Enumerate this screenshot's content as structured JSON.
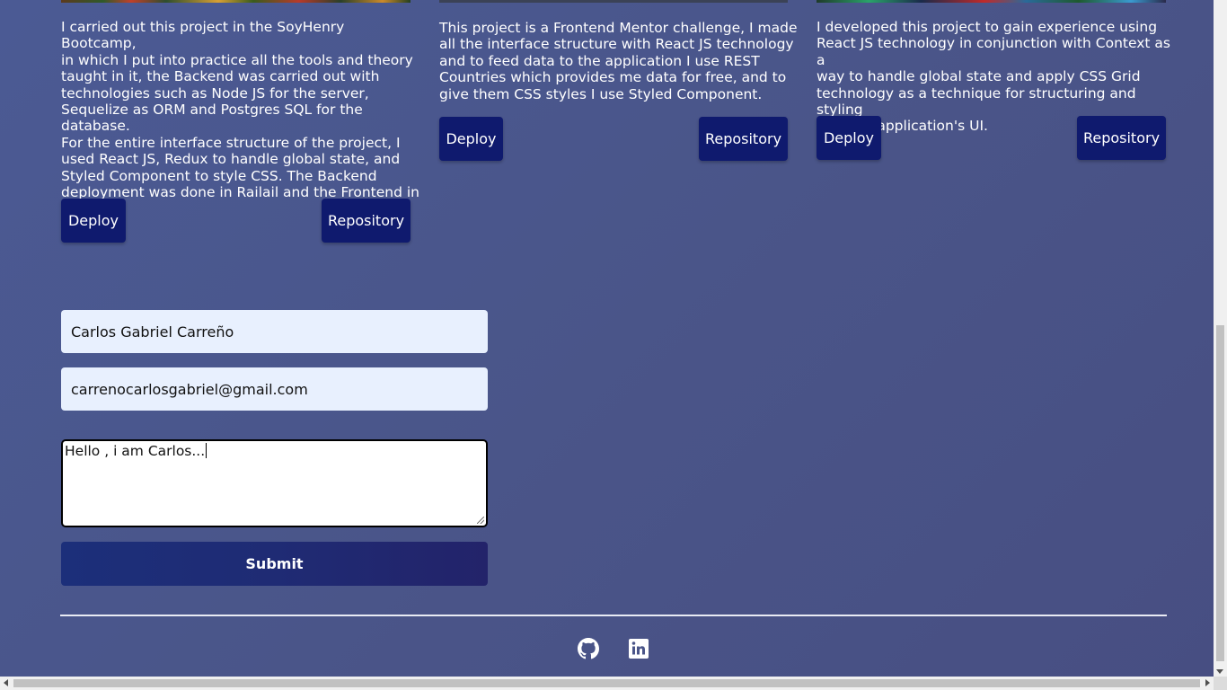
{
  "projects": [
    {
      "description": "I carried out this project in the SoyHenry Bootcamp,\nin which I put into practice all the tools and theory\ntaught in it, the Backend was carried out with\ntechnologies such as Node JS for the server,\nSequelize as ORM and Postgres SQL for the database.\nFor the entire interface structure of the project, I\nused React JS, Redux to handle global state, and\nStyled Component to style CSS. The Backend\ndeployment was done in Railail and the Frontend in\nVercel.",
      "deploy_label": "Deploy",
      "repository_label": "Repository"
    },
    {
      "description": "This project is a Frontend Mentor challenge, I made\nall the interface structure with React JS technology\nand to feed data to the application I use REST\nCountries which provides me data for free, and to\ngive them CSS styles I use Styled Component.",
      "deploy_label": "Deploy",
      "repository_label": "Repository"
    },
    {
      "description": "I developed this project to gain experience using\nReact JS technology in conjunction with Context as a\nway to handle global state and apply CSS Grid\ntechnology as a technique for structuring and styling\nthe web application's UI.",
      "deploy_label": "Deploy",
      "repository_label": "Repository"
    }
  ],
  "contact_form": {
    "name_value": "Carlos Gabriel Carreño",
    "email_value": "carrenocarlosgabriel@gmail.com",
    "message_value": "Hello , i am Carlos...",
    "submit_label": "Submit"
  },
  "footer": {
    "icons": [
      "github-icon",
      "linkedin-icon"
    ]
  },
  "colors": {
    "background": "#4a5589",
    "button": "#0f1a6e",
    "input_background": "#e8f0fe",
    "submit": "#1f2b74"
  }
}
